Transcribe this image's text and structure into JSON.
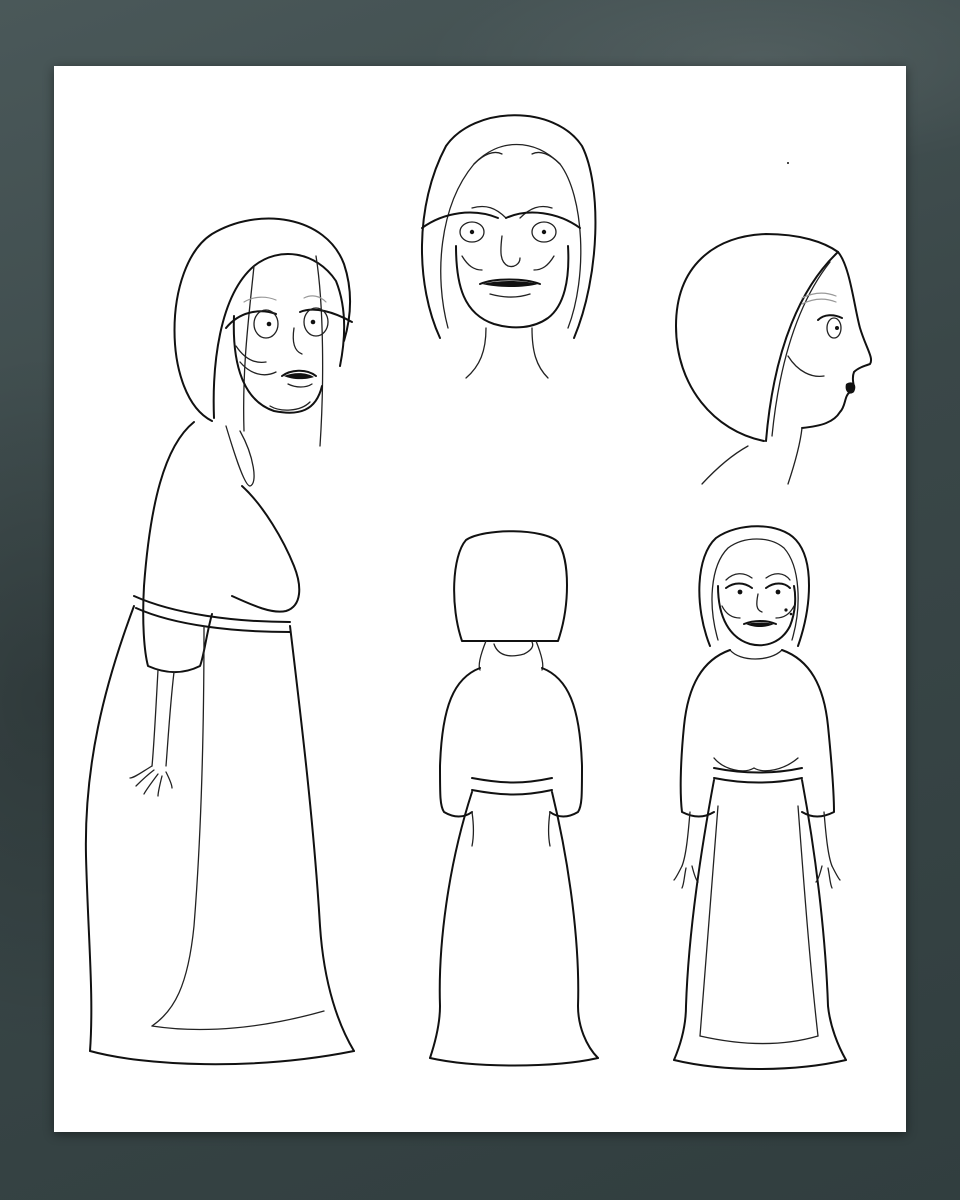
{
  "canvas": {
    "backdrop_color": "#3a4748",
    "sheet_color": "#ffffff",
    "line_color": "#111111"
  },
  "figures": [
    {
      "id": "full-body-three-quarter",
      "icon": "character-full-body-three-quarter"
    },
    {
      "id": "head-front",
      "icon": "character-head-front"
    },
    {
      "id": "head-profile",
      "icon": "character-head-profile"
    },
    {
      "id": "full-body-back",
      "icon": "character-full-body-back"
    },
    {
      "id": "full-body-front",
      "icon": "character-full-body-front"
    }
  ]
}
